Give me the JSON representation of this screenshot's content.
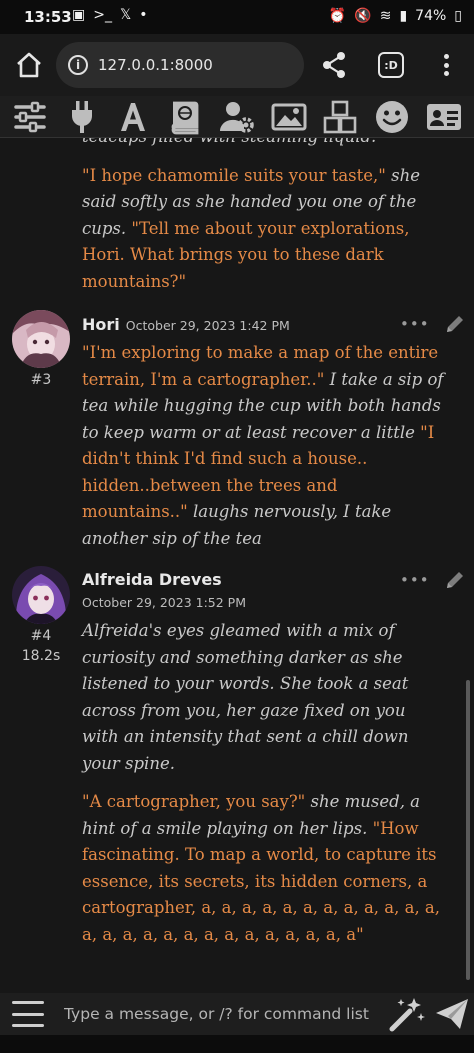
{
  "status_bar": {
    "time": "13:53",
    "battery": "74%"
  },
  "browser": {
    "url": "127.0.0.1:8000",
    "info_icon": "i",
    "tab_label": ":D"
  },
  "toolbar_icons": [
    "sliders-icon",
    "plug-icon",
    "font-icon",
    "book-icon",
    "user-gear-icon",
    "image-icon",
    "cubes-icon",
    "smiley-icon",
    "id-card-icon"
  ],
  "chat": {
    "prev_tail": {
      "line": "teacups filled with steaming liquid.",
      "q1": "\"I hope chamomile suits your taste,\"",
      "t1": " she said softly as she handed you one of the cups. ",
      "q2": "\"Tell me about your explorations, Hori. What brings you to these dark mountains?\""
    },
    "messages": [
      {
        "name": "Hori",
        "date": "October 29, 2023 1:42 PM",
        "id": "#3",
        "gen_time": "",
        "q1": "\"I'm exploring to make a map of the entire terrain, I'm a cartographer..\"",
        "t1": " I take a sip of tea while hugging the cup with both hands to keep warm or at least recover a little ",
        "q2": "\"I didn't think I'd find such a house.. hidden..between the trees and mountains..\"",
        "t2": " laughs nervously, I take another sip of the tea"
      },
      {
        "name": "Alfreida Dreves",
        "date": "October 29, 2023 1:52 PM",
        "id": "#4",
        "gen_time": "18.2s",
        "p1": "Alfreida's eyes gleamed with a mix of curiosity and something darker as she listened to your words. She took a seat across from you, her gaze fixed on you with an intensity that sent a chill down your spine.",
        "q1": "\"A cartographer, you say?\"",
        "t1": " she mused, a hint of a smile playing on her lips. ",
        "q2": "\"How fascinating. To map a world, to capture its essence, its secrets, its hidden corners, a cartographer, a, a, a, a, a, a, a, a, a, a, a, a, a, a, a, a, a, a, a, a, a, a, a, a, a, a\""
      }
    ]
  },
  "input": {
    "placeholder": "Type a message, or /? for command list"
  },
  "colors": {
    "quote": "#e58a47",
    "narration": "#c9c9c9",
    "background": "#171717"
  }
}
